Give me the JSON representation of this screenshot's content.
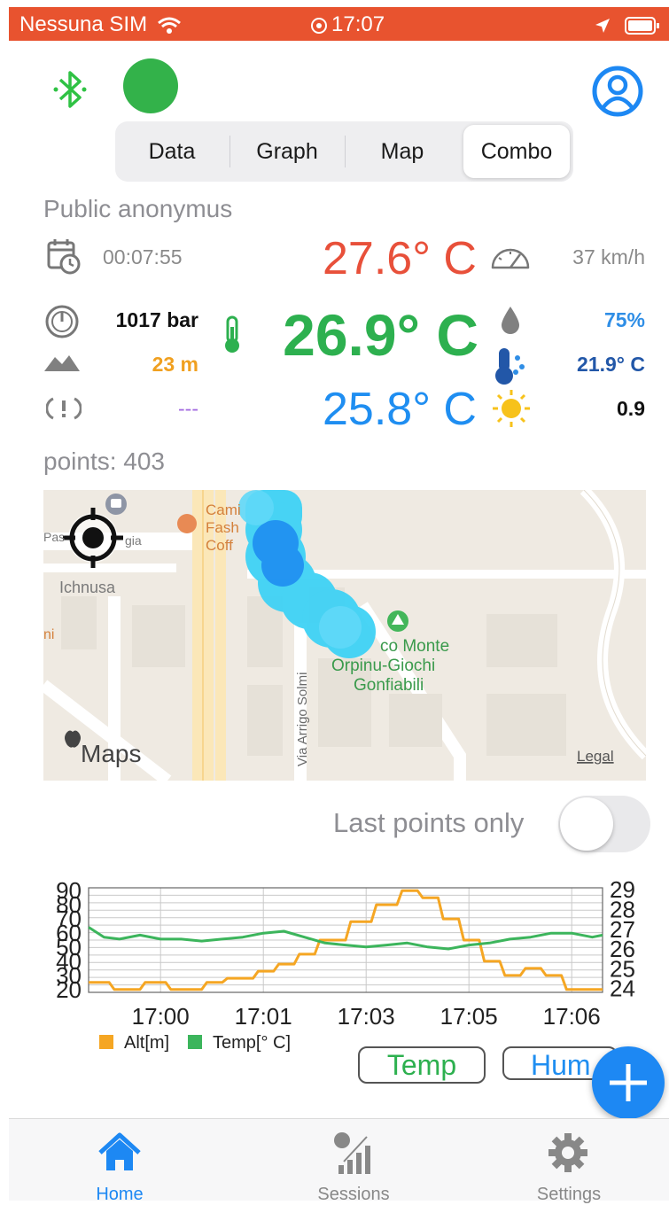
{
  "status_bar": {
    "carrier": "Nessuna SIM",
    "time": "17:07"
  },
  "segments": {
    "items": [
      "Data",
      "Graph",
      "Map",
      "Combo"
    ],
    "active": "Combo"
  },
  "user_label": "Public anonymus",
  "readings": {
    "elapsed": "00:07:55",
    "temp_max": "27.6° C",
    "speed": "37 km/h",
    "pressure": "1017 bar",
    "temp_current": "26.9° C",
    "humidity": "75%",
    "altitude": "23 m",
    "dew_point": "21.9° C",
    "rotation": "---",
    "temp_min": "25.8° C",
    "uv": "0.9"
  },
  "points_label": "points: 403",
  "map": {
    "labels": {
      "ichnusa": "Ichnusa",
      "cami": "Cami",
      "fash": "Fash",
      "coff": "Coff",
      "pas": "Pas",
      "gia": "gia",
      "ni": "ni",
      "park1": "co Monte",
      "park2": "Orpinu-Giochi",
      "park3": "Gonfiabili",
      "street": "Via Arrigo Solmi",
      "maps": "Maps",
      "legal": "Legal"
    }
  },
  "last_points_only": {
    "label": "Last points only",
    "value": false
  },
  "chart_data": {
    "type": "line",
    "x_ticks": [
      "17:00",
      "17:01",
      "17:03",
      "17:05",
      "17:06"
    ],
    "left_axis_ticks": [
      "90",
      "80",
      "70",
      "60",
      "50",
      "40",
      "30",
      "20"
    ],
    "right_axis_ticks": [
      "29",
      "28",
      "27",
      "26",
      "25",
      "24"
    ],
    "left_ylim": [
      18,
      92
    ],
    "right_ylim": [
      23.8,
      29.1
    ],
    "series": [
      {
        "name": "Alt[m]",
        "axis": "left",
        "color": "#f5a623",
        "x": [
          0,
          4,
          5,
          10,
          11,
          15,
          16,
          22,
          23,
          26,
          27,
          32,
          33,
          36,
          37,
          40,
          41,
          44,
          45,
          50,
          51,
          55,
          56,
          60,
          61,
          64,
          65,
          68,
          69,
          72,
          73,
          76,
          77,
          80,
          81,
          84,
          85,
          88,
          89,
          92,
          93,
          100
        ],
        "values": [
          25,
          25,
          20,
          20,
          25,
          25,
          20,
          20,
          25,
          25,
          28,
          28,
          33,
          33,
          38,
          38,
          45,
          45,
          55,
          55,
          68,
          68,
          80,
          80,
          90,
          90,
          85,
          85,
          70,
          70,
          55,
          55,
          40,
          40,
          30,
          30,
          35,
          35,
          30,
          30,
          20,
          20
        ]
      },
      {
        "name": "Temp[° C]",
        "axis": "right",
        "color": "#3cb55c",
        "x": [
          0,
          3,
          6,
          10,
          14,
          18,
          22,
          26,
          30,
          34,
          38,
          42,
          46,
          50,
          54,
          58,
          62,
          66,
          70,
          74,
          78,
          82,
          86,
          90,
          94,
          98,
          100
        ],
        "values": [
          27.1,
          26.6,
          26.5,
          26.7,
          26.5,
          26.5,
          26.4,
          26.5,
          26.6,
          26.8,
          26.9,
          26.6,
          26.3,
          26.2,
          26.1,
          26.2,
          26.3,
          26.1,
          26.0,
          26.2,
          26.3,
          26.5,
          26.6,
          26.8,
          26.8,
          26.6,
          26.7
        ]
      }
    ]
  },
  "chart_buttons": {
    "temp": "Temp",
    "hum": "Hum"
  },
  "tabs": [
    {
      "label": "Home",
      "active": true
    },
    {
      "label": "Sessions",
      "active": false
    },
    {
      "label": "Settings",
      "active": false
    }
  ],
  "colors": {
    "status_bar": "#e8532f",
    "accent": "#1d88f3",
    "temp_max": "#e8503a",
    "temp_current": "#2db04f",
    "temp_min": "#1f8ef1",
    "altitude": "#f0a020",
    "rotation": "#a36ae0",
    "connected": "#33b24a"
  }
}
